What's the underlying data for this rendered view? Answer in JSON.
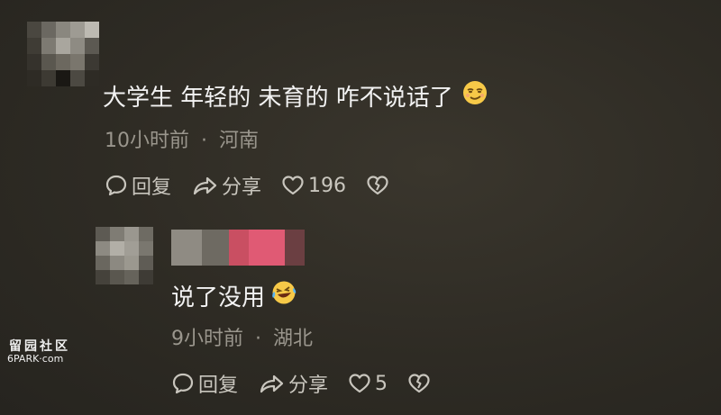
{
  "comments": [
    {
      "text": "大学生 年轻的 未育的 咋不说话了",
      "emoji": "smirk-emoji",
      "time": "10小时前",
      "separator": "·",
      "location": "河南",
      "reply_label": "回复",
      "share_label": "分享",
      "like_count": "196"
    },
    {
      "text": "说了没用",
      "emoji": "laugh-cry-emoji",
      "time": "9小时前",
      "separator": "·",
      "location": "湖北",
      "reply_label": "回复",
      "share_label": "分享",
      "like_count": "5"
    }
  ],
  "watermark": {
    "line1": "留园社区",
    "line2": "6PARK·com"
  },
  "colors": {
    "background": "#2e2b24",
    "text": "#f2f2f2",
    "meta": "#9a968d",
    "action": "#c9c6be"
  }
}
